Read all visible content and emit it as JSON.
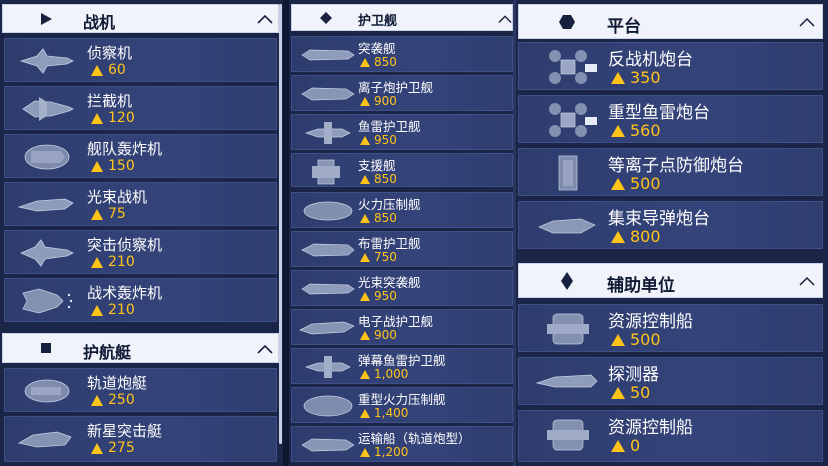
{
  "colors": {
    "cost": "#ffc31a",
    "header_bg": "#f0f3fa",
    "item_bg": "#34447a",
    "page_bg": "#1b2547"
  },
  "cost_icon": "triangle-resource-icon",
  "col1": {
    "fighters": {
      "title": "战机",
      "icon": "play-triangle-icon",
      "items": [
        {
          "name": "侦察机",
          "cost": "60"
        },
        {
          "name": "拦截机",
          "cost": "120"
        },
        {
          "name": "舰队轰炸机",
          "cost": "150"
        },
        {
          "name": "光束战机",
          "cost": "75"
        },
        {
          "name": "突击侦察机",
          "cost": "210"
        },
        {
          "name": "战术轰炸机",
          "cost": "210"
        }
      ]
    },
    "corvettes": {
      "title": "护航艇",
      "icon": "square-icon",
      "items": [
        {
          "name": "轨道炮艇",
          "cost": "250"
        },
        {
          "name": "新星突击艇",
          "cost": "275"
        }
      ]
    }
  },
  "col2": {
    "frigates": {
      "title": "护卫舰",
      "icon": "diamond-icon",
      "items": [
        {
          "name": "突袭舰",
          "cost": "850"
        },
        {
          "name": "离子炮护卫舰",
          "cost": "900"
        },
        {
          "name": "鱼雷护卫舰",
          "cost": "950"
        },
        {
          "name": "支援舰",
          "cost": "850"
        },
        {
          "name": "火力压制舰",
          "cost": "850"
        },
        {
          "name": "布雷护卫舰",
          "cost": "750"
        },
        {
          "name": "光束突袭舰",
          "cost": "950"
        },
        {
          "name": "电子战护卫舰",
          "cost": "900"
        },
        {
          "name": "弹幕鱼雷护卫舰",
          "cost": "1,000"
        },
        {
          "name": "重型火力压制舰",
          "cost": "1,400"
        },
        {
          "name": "运输船（轨道炮型）",
          "cost": "1,200"
        }
      ]
    }
  },
  "col3": {
    "platforms": {
      "title": "平台",
      "icon": "hexagon-icon",
      "items": [
        {
          "name": "反战机炮台",
          "cost": "350"
        },
        {
          "name": "重型鱼雷炮台",
          "cost": "560"
        },
        {
          "name": "等离子点防御炮台",
          "cost": "500"
        },
        {
          "name": "集束导弹炮台",
          "cost": "800"
        }
      ]
    },
    "support": {
      "title": "辅助单位",
      "icon": "crystal-diamond-icon",
      "items": [
        {
          "name": "资源控制船",
          "cost": "500"
        },
        {
          "name": "探测器",
          "cost": "50"
        },
        {
          "name": "资源控制船",
          "cost": "0"
        }
      ]
    }
  }
}
